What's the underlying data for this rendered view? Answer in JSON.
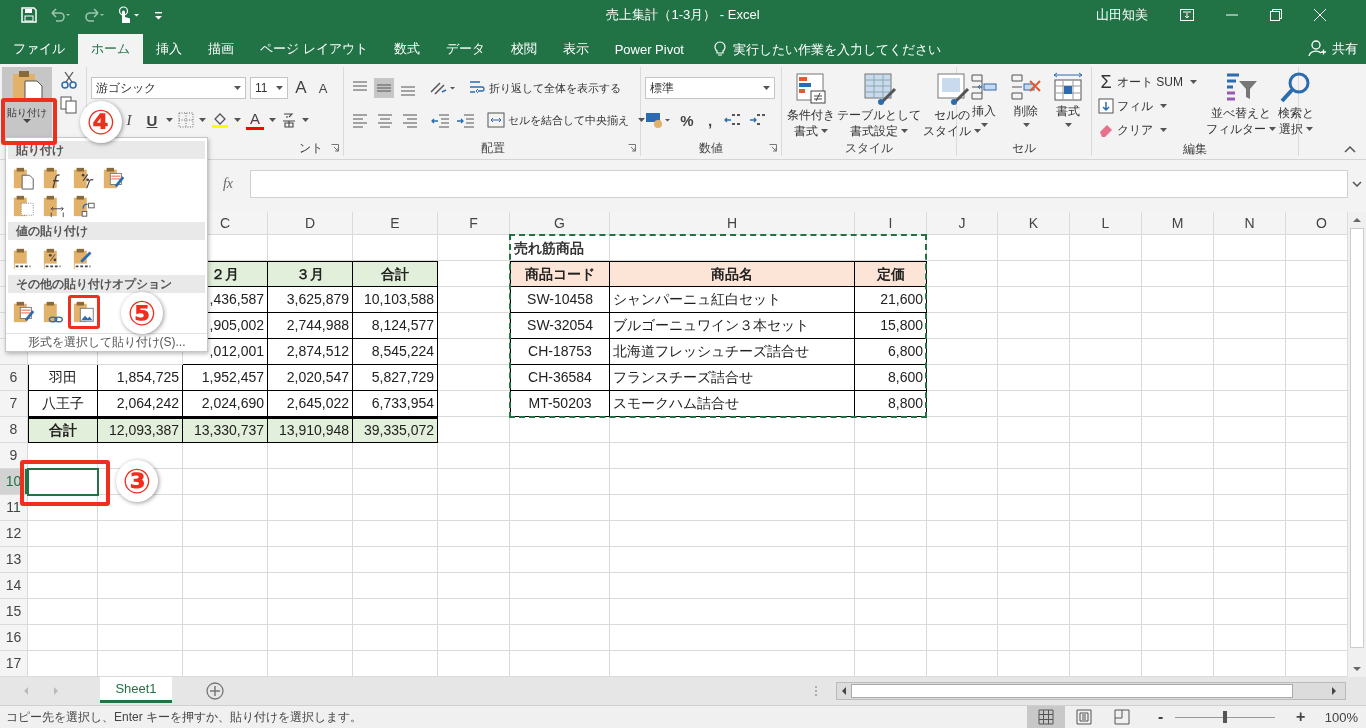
{
  "title_bar": {
    "title": "売上集計（1-3月） - Excel",
    "user": "山田知美"
  },
  "tabs": [
    {
      "label": "ファイル",
      "selected": false
    },
    {
      "label": "ホーム",
      "selected": true
    },
    {
      "label": "挿入",
      "selected": false
    },
    {
      "label": "描画",
      "selected": false
    },
    {
      "label": "ページ レイアウト",
      "selected": false
    },
    {
      "label": "数式",
      "selected": false
    },
    {
      "label": "データ",
      "selected": false
    },
    {
      "label": "校閲",
      "selected": false
    },
    {
      "label": "表示",
      "selected": false
    },
    {
      "label": "Power Pivot",
      "selected": false
    }
  ],
  "tell_me": {
    "placeholder": "実行したい作業を入力してください"
  },
  "share": "共有",
  "ribbon": {
    "clipboard": {
      "paste": "貼り付け"
    },
    "font": {
      "name": "游ゴシック",
      "size": "11",
      "grow": "A",
      "shrink": "A",
      "italic": "I",
      "underline": "U",
      "font_color": "A",
      "group_label": "ント"
    },
    "alignment": {
      "wrap_text": "折り返して全体を表示する",
      "merge": "セルを結合して中央揃え",
      "group_label": "配置"
    },
    "number": {
      "format": "標準",
      "percent": "%",
      "comma": ",",
      "group_label": "数値"
    },
    "styles": {
      "buttons": [
        {
          "kind": "conditional",
          "lines": [
            "条件付き",
            "書式"
          ]
        },
        {
          "kind": "table",
          "lines": [
            "テーブルとして",
            "書式設定"
          ]
        },
        {
          "kind": "cell-styles",
          "lines": [
            "セルの",
            "スタイル"
          ]
        }
      ],
      "group_label": "スタイル"
    },
    "cells": {
      "buttons": [
        {
          "kind": "insert",
          "label": "挿入"
        },
        {
          "kind": "delete",
          "label": "削除"
        },
        {
          "kind": "format",
          "label": "書式"
        }
      ],
      "group_label": "セル"
    },
    "editing": {
      "sigma": "Σ",
      "autosum": "オート SUM",
      "fill": "フィル",
      "clear": "クリア",
      "buttons": [
        {
          "kind": "sort",
          "lines": [
            "並べ替えと",
            "フィルター"
          ]
        },
        {
          "kind": "find",
          "lines": [
            "検索と",
            "選択"
          ]
        }
      ],
      "group_label": "編集"
    }
  },
  "formula_bar": {
    "function_label": "fx"
  },
  "paste_menu": {
    "sections": [
      {
        "title": "貼り付け",
        "options": [
          {
            "kind": "paste"
          },
          {
            "kind": "formulas"
          },
          {
            "kind": "formulas-number"
          },
          {
            "kind": "source-format"
          },
          {
            "kind": "no-borders"
          },
          {
            "kind": "column-widths"
          },
          {
            "kind": "transpose"
          }
        ]
      },
      {
        "title": "値の貼り付け",
        "options": [
          {
            "kind": "values"
          },
          {
            "kind": "values-number"
          },
          {
            "kind": "values-source"
          }
        ]
      },
      {
        "title": "その他の貼り付けオプション",
        "options": [
          {
            "kind": "formatting"
          },
          {
            "kind": "link"
          },
          {
            "kind": "picture"
          }
        ]
      }
    ],
    "special": "形式を選択して貼り付け(S)..."
  },
  "sheet": {
    "column_headers": [
      {
        "label": "C",
        "selected": false
      },
      {
        "label": "D",
        "selected": false
      },
      {
        "label": "E",
        "selected": false
      },
      {
        "label": "F",
        "selected": false
      },
      {
        "label": "G",
        "selected": false
      },
      {
        "label": "H",
        "selected": false
      },
      {
        "label": "I",
        "selected": false
      },
      {
        "label": "J",
        "selected": false
      },
      {
        "label": "K",
        "selected": false
      },
      {
        "label": "L",
        "selected": false
      },
      {
        "label": "M",
        "selected": false
      },
      {
        "label": "N",
        "selected": false
      },
      {
        "label": "O",
        "selected": false
      }
    ],
    "row_headers": [
      {
        "label": "6",
        "selected": false
      },
      {
        "label": "7",
        "selected": false
      },
      {
        "label": "8",
        "selected": false
      },
      {
        "label": "9",
        "selected": false
      },
      {
        "label": "10",
        "selected": true
      },
      {
        "label": "11",
        "selected": false
      },
      {
        "label": "12",
        "selected": false
      },
      {
        "label": "13",
        "selected": false
      },
      {
        "label": "14",
        "selected": false
      },
      {
        "label": "15",
        "selected": false
      },
      {
        "label": "16",
        "selected": false
      },
      {
        "label": "17",
        "selected": false
      }
    ]
  },
  "sales_table": {
    "header": [
      "２月",
      "３月",
      "合計"
    ],
    "rows": [
      [
        ",436,587",
        "3,625,879",
        "10,103,588"
      ],
      [
        ",905,002",
        "2,744,988",
        "8,124,577"
      ],
      [
        ",012,001",
        "2,874,512",
        "8,545,224"
      ],
      [
        "羽田",
        "1,854,725",
        "1,952,457",
        "2,020,547",
        "5,827,729"
      ],
      [
        "八王子",
        "2,064,242",
        "2,024,690",
        "2,645,022",
        "6,733,954"
      ]
    ],
    "total": [
      "合計",
      "12,093,387",
      "13,330,737",
      "13,910,948",
      "39,335,072"
    ]
  },
  "bestseller_table": {
    "title": "売れ筋商品",
    "columns": [
      "商品コード",
      "商品名",
      "定価"
    ],
    "rows": [
      [
        "SW-10458",
        "シャンパーニュ紅白セット",
        "21,600"
      ],
      [
        "SW-32054",
        "ブルゴーニュワイン３本セット",
        "15,800"
      ],
      [
        "CH-18753",
        "北海道フレッシュチーズ詰合せ",
        "6,800"
      ],
      [
        "CH-36584",
        "フランスチーズ詰合せ",
        "8,600"
      ],
      [
        "MT-50203",
        "スモークハム詰合せ",
        "8,800"
      ]
    ],
    "copied": true
  },
  "sheet_tabs": [
    {
      "label": "Sheet1",
      "selected": true
    }
  ],
  "status_bar": {
    "message": "コピー先を選択し、Enter キーを押すか、貼り付けを選択します。",
    "views": [
      {
        "kind": "normal",
        "selected": true
      },
      {
        "kind": "page-layout",
        "selected": false
      },
      {
        "kind": "page-break",
        "selected": false
      }
    ],
    "zoom_out": "-",
    "zoom_in": "+",
    "zoom": {
      "level": 0.5
    },
    "zoom_value": "100%"
  },
  "annotations": [
    {
      "label": "④"
    },
    {
      "label": "⑤"
    },
    {
      "label": "③"
    }
  ]
}
